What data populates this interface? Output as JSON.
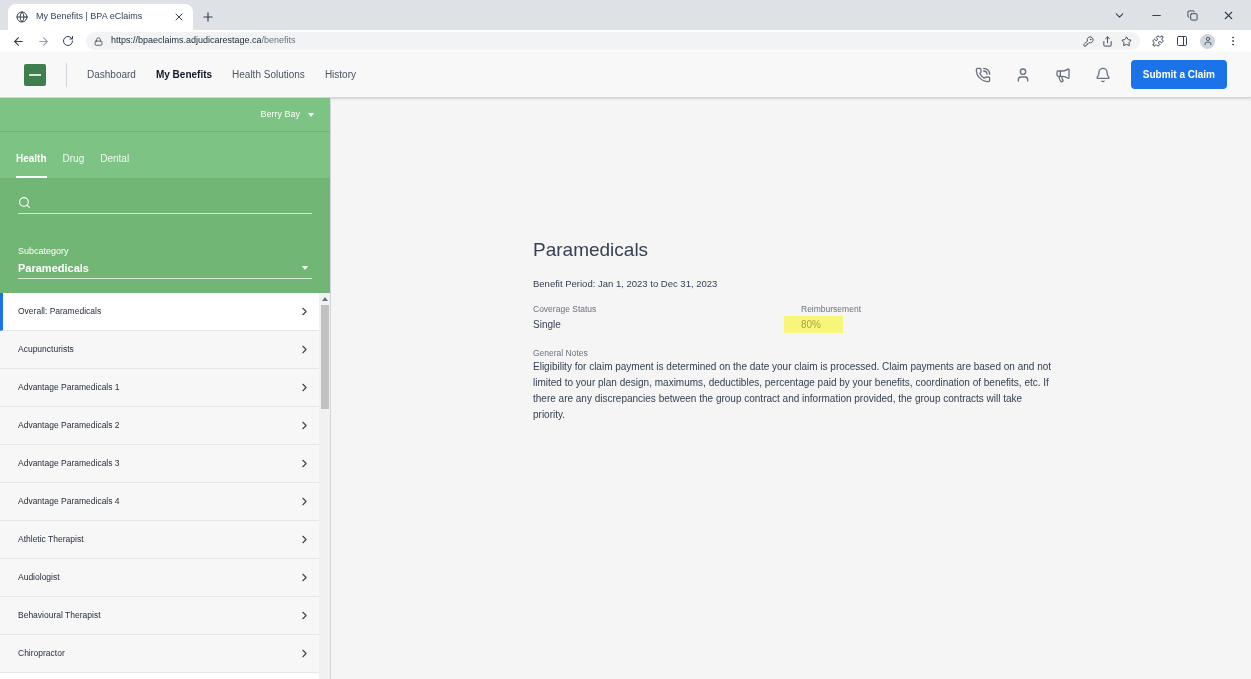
{
  "browser": {
    "tab_title": "My Benefits | BPA eClaims",
    "url_host": "https://bpaeclaims.adjudicarestage.ca",
    "url_path": "/benefits"
  },
  "nav": {
    "links": [
      {
        "label": "Dashboard",
        "selected": false
      },
      {
        "label": "My Benefits",
        "selected": true
      },
      {
        "label": "Health Solutions",
        "selected": false
      },
      {
        "label": "History",
        "selected": false
      }
    ],
    "submit_button": "Submit a Claim"
  },
  "sidebar": {
    "account": "Berry Bay",
    "tabs": [
      {
        "label": "Health",
        "selected": true
      },
      {
        "label": "Drug",
        "selected": false
      },
      {
        "label": "Dental",
        "selected": false
      }
    ],
    "subcategory_label": "Subcategory",
    "subcategory_value": "Paramedicals",
    "items": [
      {
        "label": "Overall: Paramedicals",
        "selected": true
      },
      {
        "label": "Acupuncturists",
        "selected": false
      },
      {
        "label": "Advantage Paramedicals 1",
        "selected": false
      },
      {
        "label": "Advantage Paramedicals 2",
        "selected": false
      },
      {
        "label": "Advantage Paramedicals 3",
        "selected": false
      },
      {
        "label": "Advantage Paramedicals 4",
        "selected": false
      },
      {
        "label": "Athletic Therapist",
        "selected": false
      },
      {
        "label": "Audiologist",
        "selected": false
      },
      {
        "label": "Behavioural Therapist",
        "selected": false
      },
      {
        "label": "Chiropractor",
        "selected": false
      }
    ]
  },
  "detail": {
    "title": "Paramedicals",
    "period": "Benefit Period: Jan 1, 2023 to Dec 31, 2023",
    "fields": [
      {
        "label": "Coverage Status",
        "value": "Single",
        "highlighted": false
      },
      {
        "label": "Reimbursement",
        "value": "80%",
        "highlighted": true
      }
    ],
    "notes_label": "General Notes",
    "notes": "Eligibility for claim payment is determined on the date your claim is processed. Claim payments are based on and not limited to your plan design, maximums, deductibles, percentage paid by your benefits, coordination of benefits, etc. If there are any discrepancies between the group contract and information provided, the group contracts will take priority."
  }
}
